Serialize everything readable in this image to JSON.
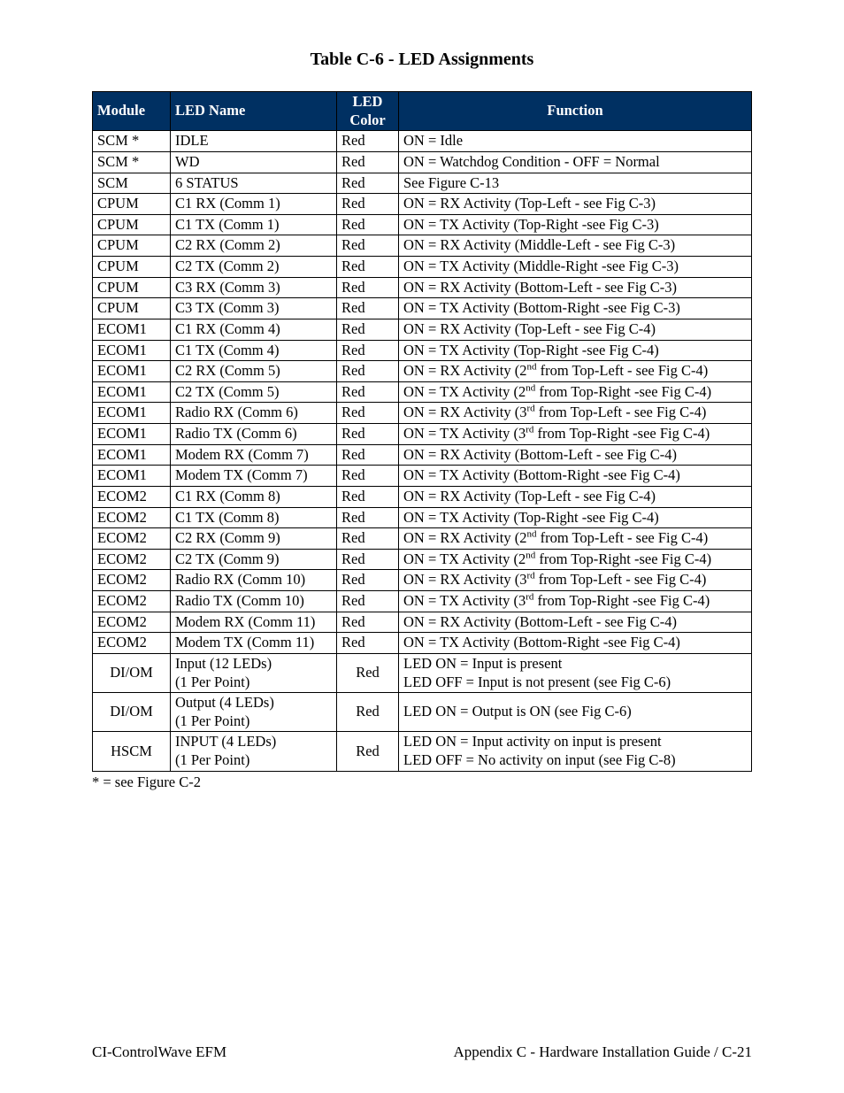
{
  "title": "Table C-6 - LED Assignments",
  "headers": {
    "module": "Module",
    "name": "LED Name",
    "color": "LED Color",
    "func": "Function"
  },
  "rows": [
    {
      "module": "SCM *",
      "name": "IDLE",
      "color": "Red",
      "func": [
        "ON = Idle"
      ]
    },
    {
      "module": "SCM *",
      "name": "WD",
      "color": "Red",
      "func": [
        "ON = Watchdog Condition - OFF = Normal"
      ]
    },
    {
      "module": "SCM",
      "name": "6 STATUS",
      "color": "Red",
      "func": [
        "See Figure C-13"
      ]
    },
    {
      "module": "CPUM",
      "name": "C1 RX (Comm 1)",
      "color": "Red",
      "func": [
        "ON = RX Activity (Top-Left - see Fig C-3)"
      ]
    },
    {
      "module": "CPUM",
      "name": "C1 TX (Comm 1)",
      "color": "Red",
      "func": [
        "ON = TX Activity (Top-Right -see Fig C-3)"
      ]
    },
    {
      "module": "CPUM",
      "name": "C2 RX (Comm 2)",
      "color": "Red",
      "func": [
        "ON = RX Activity (Middle-Left - see Fig C-3)"
      ]
    },
    {
      "module": "CPUM",
      "name": "C2 TX (Comm 2)",
      "color": "Red",
      "func": [
        "ON = TX Activity (Middle-Right -see Fig C-3)"
      ]
    },
    {
      "module": "CPUM",
      "name": "C3 RX (Comm 3)",
      "color": "Red",
      "func": [
        "ON = RX Activity (Bottom-Left - see Fig C-3)"
      ]
    },
    {
      "module": "CPUM",
      "name": "C3 TX (Comm 3)",
      "color": "Red",
      "func": [
        "ON = TX Activity (Bottom-Right -see Fig C-3)"
      ]
    },
    {
      "module": "ECOM1",
      "name": "C1 RX (Comm 4)",
      "color": "Red",
      "func": [
        "ON = RX Activity (Top-Left - see Fig C-4)"
      ]
    },
    {
      "module": "ECOM1",
      "name": "C1 TX (Comm 4)",
      "color": "Red",
      "func": [
        "ON = TX Activity (Top-Right -see Fig C-4)"
      ]
    },
    {
      "module": "ECOM1",
      "name": "C2 RX (Comm 5)",
      "color": "Red",
      "func": [
        "ON = RX Activity (2",
        "nd",
        " from Top-Left - see Fig C-4)"
      ]
    },
    {
      "module": "ECOM1",
      "name": "C2 TX (Comm 5)",
      "color": "Red",
      "func": [
        "ON = TX Activity (2",
        "nd",
        " from Top-Right -see Fig C-4)"
      ]
    },
    {
      "module": "ECOM1",
      "name": "Radio RX (Comm 6)",
      "color": "Red",
      "func": [
        "ON = RX Activity (3",
        "rd",
        " from Top-Left - see Fig C-4)"
      ]
    },
    {
      "module": "ECOM1",
      "name": "Radio TX (Comm 6)",
      "color": "Red",
      "func": [
        "ON = TX Activity (3",
        "rd",
        " from Top-Right -see Fig C-4)"
      ]
    },
    {
      "module": "ECOM1",
      "name": "Modem RX (Comm 7)",
      "color": "Red",
      "func": [
        "ON = RX Activity (Bottom-Left - see Fig C-4)"
      ]
    },
    {
      "module": "ECOM1",
      "name": "Modem TX (Comm 7)",
      "color": "Red",
      "func": [
        "ON = TX Activity (Bottom-Right -see Fig C-4)"
      ]
    },
    {
      "module": "ECOM2",
      "name": "C1 RX (Comm 8)",
      "color": "Red",
      "func": [
        "ON = RX Activity (Top-Left - see Fig C-4)"
      ]
    },
    {
      "module": "ECOM2",
      "name": "C1 TX (Comm 8)",
      "color": "Red",
      "func": [
        "ON = TX Activity (Top-Right -see Fig C-4)"
      ]
    },
    {
      "module": "ECOM2",
      "name": "C2 RX (Comm 9)",
      "color": "Red",
      "func": [
        "ON = RX Activity (2",
        "nd",
        " from Top-Left - see Fig C-4)"
      ]
    },
    {
      "module": "ECOM2",
      "name": "C2 TX (Comm 9)",
      "color": "Red",
      "func": [
        "ON = TX Activity (2",
        "nd",
        " from Top-Right -see Fig C-4)"
      ]
    },
    {
      "module": "ECOM2",
      "name": "Radio RX (Comm 10)",
      "color": "Red",
      "func": [
        "ON = RX Activity (3",
        "rd",
        " from Top-Left - see Fig C-4)"
      ]
    },
    {
      "module": "ECOM2",
      "name": "Radio TX (Comm 10)",
      "color": "Red",
      "func": [
        "ON = TX Activity (3",
        "rd",
        " from Top-Right -see Fig C-4)"
      ]
    },
    {
      "module": "ECOM2",
      "name": "Modem RX (Comm 11)",
      "color": "Red",
      "func": [
        "ON = RX Activity (Bottom-Left - see Fig C-4)"
      ]
    },
    {
      "module": "ECOM2",
      "name": "Modem TX (Comm 11)",
      "color": "Red",
      "func": [
        "ON = TX Activity (Bottom-Right -see Fig C-4)"
      ]
    },
    {
      "module": "DI/OM",
      "name": "Input (12 LEDs)\n(1 Per Point)",
      "color": "Red",
      "func": [
        "LED ON = Input is present\nLED OFF = Input is not present (see Fig C-6)"
      ]
    },
    {
      "module": "DI/OM",
      "name": "Output (4 LEDs)\n(1 Per Point)",
      "color": "Red",
      "func": [
        "LED ON = Output is ON (see Fig C-6)"
      ]
    },
    {
      "module": "HSCM",
      "name": "INPUT (4 LEDs)\n(1 Per Point)",
      "color": "Red",
      "func": [
        "LED ON = Input activity on input is present\nLED OFF = No activity on input (see Fig C-8)"
      ]
    }
  ],
  "footnote": "* = see Figure C-2",
  "footer": {
    "left": "CI-ControlWave EFM",
    "right": "Appendix C - Hardware Installation Guide / C-21"
  }
}
